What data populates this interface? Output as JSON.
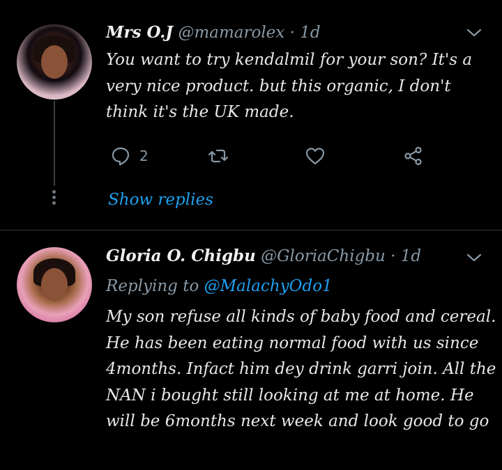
{
  "tweets": [
    {
      "name": "Mrs O.J",
      "handle": "@mamarolex",
      "separator": "·",
      "time": "1d",
      "text": "You want to try kendalmil for your son? It's a very nice product. but this organic, I don't think it's the UK made.",
      "reply_count": "2",
      "show_replies": "Show replies"
    },
    {
      "name": "Gloria O. Chigbu",
      "handle": "@GloriaChigbu",
      "separator": "·",
      "time": "1d",
      "replying_to_prefix": "Replying to",
      "replying_to_user": "@MalachyOdo1",
      "text": "My son refuse all kinds of baby food and cereal. He has been eating normal food with us since 4months. Infact him dey drink garri join. All the NAN i bought still looking at me at home. He will be 6months next week and look good to go"
    }
  ],
  "colors": {
    "background": "#000000",
    "text": "#e8e8e8",
    "secondary": "#8899a6",
    "accent": "#1da1f2",
    "divider": "#2f3336"
  },
  "icons": [
    "chevron-down-icon",
    "reply-icon",
    "retweet-icon",
    "like-icon",
    "share-icon"
  ]
}
